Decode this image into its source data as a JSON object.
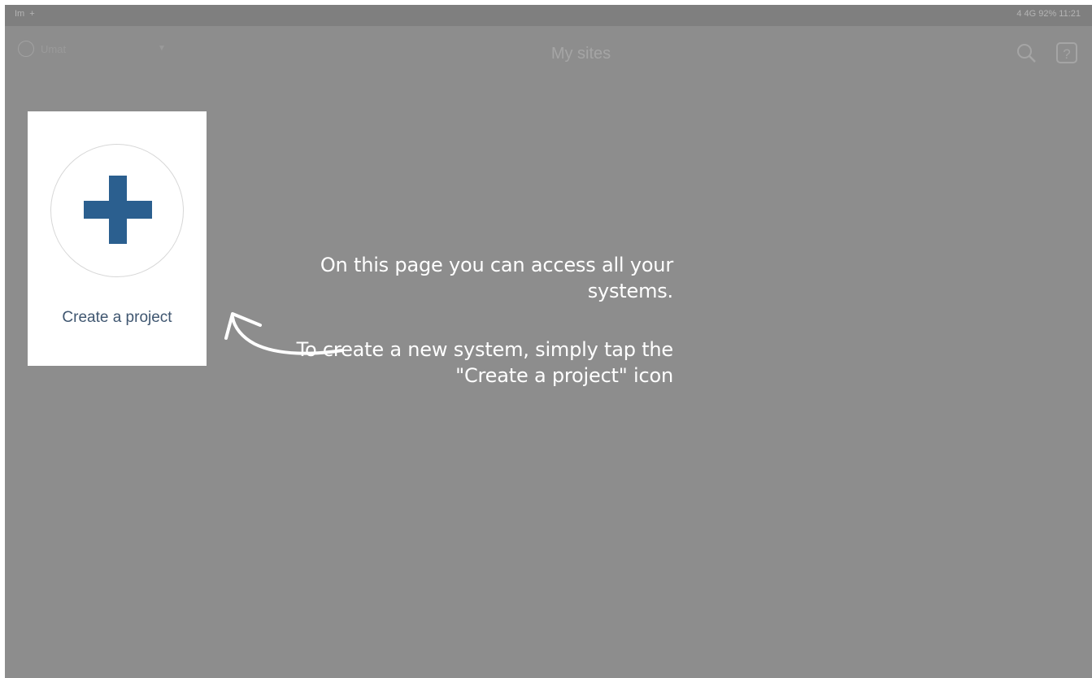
{
  "statusbar": {
    "left_icons": [
      "Im",
      "+"
    ],
    "right_text": "4 4G 92% 11:21"
  },
  "appbar": {
    "user_name": "Umat",
    "page_title": "My sites",
    "icons": [
      "search-icon",
      "help-icon"
    ]
  },
  "project_card": {
    "label": "Create a project",
    "accent_color": "#2b5f8f"
  },
  "tutorial": {
    "line1": "On this page you can access all your systems.",
    "line2": "To create a new system, simply tap the \"Create a project\" icon"
  }
}
